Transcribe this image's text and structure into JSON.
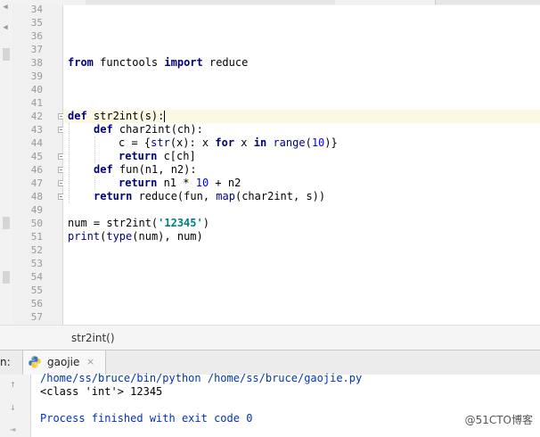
{
  "gutter": {
    "line_numbers": [
      "34",
      "35",
      "36",
      "37",
      "38",
      "39",
      "40",
      "41",
      "42",
      "43",
      "44",
      "45",
      "46",
      "47",
      "48",
      "49",
      "50",
      "51",
      "52",
      "53",
      "54",
      "55",
      "56",
      "57"
    ]
  },
  "code": {
    "l38": {
      "kw1": "from",
      "mod": " functools ",
      "kw2": "import",
      "rest": " reduce"
    },
    "l42": {
      "kw": "def",
      "rest": " str2int(s):"
    },
    "l43": {
      "kw": "def",
      "rest": " char2int(ch):"
    },
    "l44": {
      "a": "c = {",
      "b1": "str",
      "b": "(x): x ",
      "kw1": "for",
      "c": " x ",
      "kw2": "in",
      "d": " ",
      "b2": "range",
      "e": "(",
      "n": "10",
      "f": ")}"
    },
    "l45": {
      "kw": "return",
      "rest": " c[ch]"
    },
    "l46": {
      "kw": "def",
      "rest": " fun(n1, n2):"
    },
    "l47": {
      "kw": "return",
      "a": " n1 * ",
      "n": "10",
      "b": " + n2"
    },
    "l48": {
      "kw": "return",
      "a": " reduce(fun, ",
      "bi": "map",
      "b": "(char2int, s))"
    },
    "l50": {
      "a": "num = str2int(",
      "s": "'12345'",
      "b": ")"
    },
    "l51": {
      "bi1": "print",
      "a": "(",
      "bi2": "type",
      "b": "(num), num)"
    }
  },
  "breadcrumb": {
    "item": "str2int()"
  },
  "run_panel": {
    "label": "n:",
    "tab_name": "gaojie",
    "tab_close": "×",
    "output": [
      "/home/ss/bruce/bin/python /home/ss/bruce/gaojie.py",
      "<class 'int'> 12345",
      "",
      "Process finished with exit code 0"
    ]
  },
  "watermark": "@51CTO博客",
  "colors": {
    "keyword": "#000080",
    "number": "#0000ff",
    "string": "#008080",
    "current_line": "#fbf8e3",
    "console_path": "#0033b3"
  }
}
